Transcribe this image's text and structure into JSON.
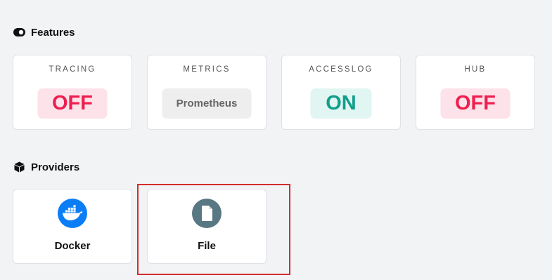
{
  "features": {
    "title": "Features",
    "icon": "toggle-icon",
    "cards": [
      {
        "label": "TRACING",
        "value": "OFF",
        "state": "off"
      },
      {
        "label": "METRICS",
        "value": "Prometheus",
        "state": "text"
      },
      {
        "label": "ACCESSLOG",
        "value": "ON",
        "state": "on"
      },
      {
        "label": "HUB",
        "value": "OFF",
        "state": "off"
      }
    ]
  },
  "providers": {
    "title": "Providers",
    "icon": "cube-icon",
    "items": [
      {
        "name": "Docker",
        "icon": "docker-icon",
        "color": "#0b7ef6"
      },
      {
        "name": "File",
        "icon": "file-icon",
        "color": "#587883"
      }
    ]
  },
  "colors": {
    "off_text": "#ee1f4f",
    "off_bg": "#fde2ea",
    "on_text": "#129e8b",
    "on_bg": "#e1f5f2",
    "highlight_border": "#d12e2e"
  }
}
